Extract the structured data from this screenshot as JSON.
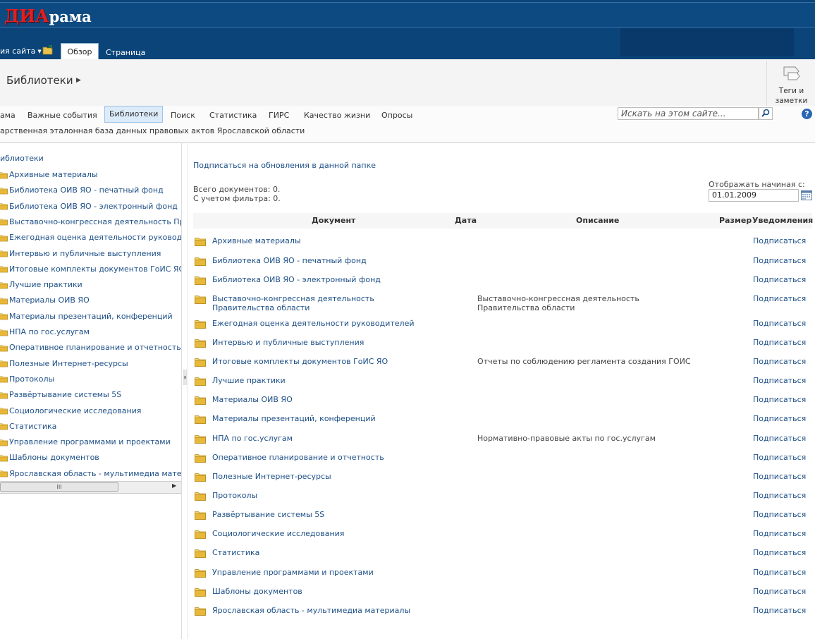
{
  "banner": {
    "logo_red": "ДИА",
    "logo_white": "рама"
  },
  "ribbon": {
    "site_actions": "ия сайта",
    "tab_overview": "Обзор",
    "tab_page": "Страница"
  },
  "header": {
    "title": "Библиотеки",
    "tags_label_1": "Теги и",
    "tags_label_2": "заметки"
  },
  "nav": {
    "items": [
      "ама",
      "Важные события",
      "Библиотеки",
      "Поиск",
      "Статистика",
      "ГИРС",
      "Качество жизни",
      "Опросы"
    ],
    "selected": "Библиотеки",
    "search_placeholder": "Искать на этом сайте...",
    "breadcrumb": "арственная эталонная база данных правовых актов Ярославской области"
  },
  "tree": {
    "root": "иблиотеки",
    "items": [
      "Архивные материалы",
      "Библиотека ОИВ ЯО - печатный фонд",
      "Библиотека ОИВ ЯО - электронный фонд",
      "Выставочно-конгрессная деятельность Прав",
      "Ежегодная оценка деятельности руководите",
      "Интервью и публичные выступления",
      "Итоговые комплекты документов ГоИС ЯО",
      "Лучшие практики",
      "Материалы ОИВ ЯО",
      "Материалы презентаций, конференций",
      "НПА по гос.услугам",
      "Оперативное планирование и отчетность",
      "Полезные Интернет-ресурсы",
      "Протоколы",
      "Развёртывание системы 5S",
      "Социологические исследования",
      "Статистика",
      "Управление программами и проектами",
      "Шаблоны документов",
      "Ярославская область - мультимедиа матери"
    ]
  },
  "main": {
    "subscribe_folder": "Подписаться на обновления в данной папке",
    "total_docs": "Всего документов: 0.",
    "filtered_docs": "С учетом фильтра: 0.",
    "from_label": "Отображать начиная с:",
    "from_value": "01.01.2009",
    "columns": {
      "doc": "Документ",
      "date": "Дата",
      "desc": "Описание",
      "size": "Размер",
      "notify": "Уведомления"
    },
    "rows": [
      {
        "name": "Архивные материалы",
        "desc": "",
        "action": "Подписаться"
      },
      {
        "name": "Библиотека ОИВ ЯО - печатный фонд",
        "desc": "",
        "action": "Подписаться"
      },
      {
        "name": "Библиотека ОИВ ЯО - электронный фонд",
        "desc": "",
        "action": "Подписаться"
      },
      {
        "name": "Выставочно-конгрессная деятельность Правительства области",
        "desc": "Выставочно-конгрессная деятельность Правительства области",
        "action": "Подписаться"
      },
      {
        "name": "Ежегодная оценка деятельности руководителей",
        "desc": "",
        "action": "Подписаться"
      },
      {
        "name": "Интервью и публичные выступления",
        "desc": "",
        "action": "Подписаться"
      },
      {
        "name": "Итоговые комплекты документов ГоИС ЯО",
        "desc": "Отчеты по соблюдению регламента создания ГОИС",
        "action": "Подписаться"
      },
      {
        "name": "Лучшие практики",
        "desc": "",
        "action": "Подписаться"
      },
      {
        "name": "Материалы ОИВ ЯО",
        "desc": "",
        "action": "Подписаться"
      },
      {
        "name": "Материалы презентаций, конференций",
        "desc": "",
        "action": "Подписаться"
      },
      {
        "name": "НПА по гос.услугам",
        "desc": "Нормативно-правовые акты по гос.услугам",
        "action": "Подписаться"
      },
      {
        "name": "Оперативное планирование и отчетность",
        "desc": "",
        "action": "Подписаться"
      },
      {
        "name": "Полезные Интернет-ресурсы",
        "desc": "",
        "action": "Подписаться"
      },
      {
        "name": "Протоколы",
        "desc": "",
        "action": "Подписаться"
      },
      {
        "name": "Развёртывание системы 5S",
        "desc": "",
        "action": "Подписаться"
      },
      {
        "name": "Социологические исследования",
        "desc": "",
        "action": "Подписаться"
      },
      {
        "name": "Статистика",
        "desc": "",
        "action": "Подписаться"
      },
      {
        "name": "Управление программами и проектами",
        "desc": "",
        "action": "Подписаться"
      },
      {
        "name": "Шаблоны документов",
        "desc": "",
        "action": "Подписаться"
      },
      {
        "name": "Ярославская область - мультимедиа материалы",
        "desc": "",
        "action": "Подписаться"
      }
    ]
  },
  "colors": {
    "banner": "#0a4479",
    "link": "#1d4f86",
    "folder": "#e8b83a"
  },
  "icons": {
    "folder": "folder-icon",
    "search": "search-icon",
    "help": "help-icon",
    "calendar": "calendar-icon",
    "tags": "tags-icon"
  }
}
